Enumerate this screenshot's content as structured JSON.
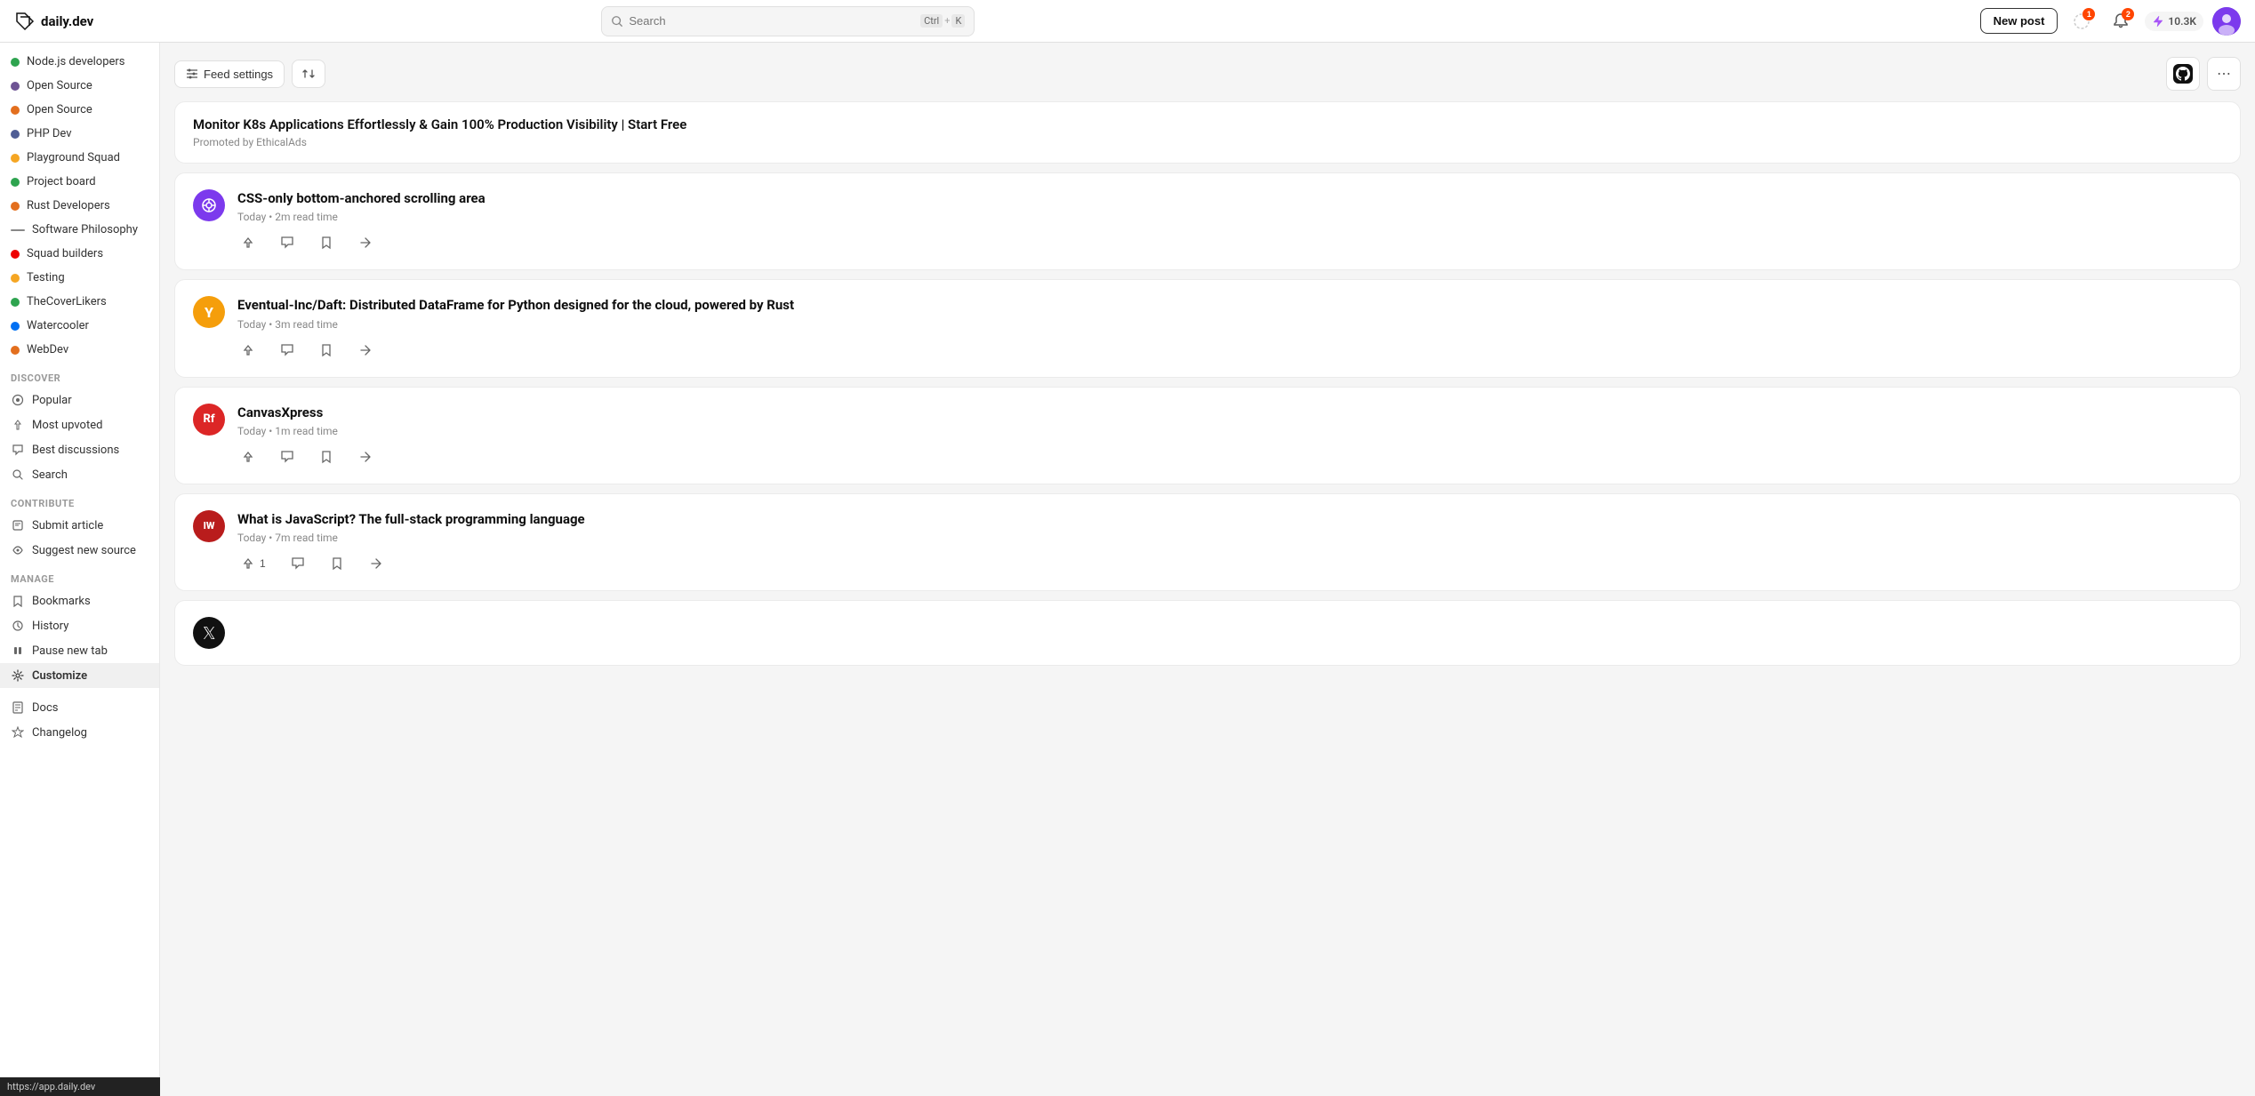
{
  "app": {
    "name": "daily.dev"
  },
  "topnav": {
    "search_placeholder": "Search",
    "shortcut_ctrl": "Ctrl",
    "shortcut_plus": "+",
    "shortcut_key": "K",
    "new_post_label": "New post",
    "notification_count": "1",
    "notification_badge": "2",
    "rep_count": "10.3K"
  },
  "sidebar": {
    "squads_label": "",
    "items_top": [
      {
        "label": "Node.js developers",
        "color": "#2ea44f",
        "type": "dot"
      },
      {
        "label": "Open Source",
        "color": "#6e5494",
        "type": "dot"
      },
      {
        "label": "Open Source",
        "color": "#e36f1e",
        "type": "dot"
      },
      {
        "label": "PHP Dev",
        "color": "#4f5d95",
        "type": "dot"
      },
      {
        "label": "Playground Squad",
        "color": "#f5a623",
        "type": "dot"
      },
      {
        "label": "Project board",
        "color": "#2ea44f",
        "type": "dot"
      },
      {
        "label": "Rust Developers",
        "color": "#e36f1e",
        "type": "dot"
      },
      {
        "label": "Software Philosophy",
        "color": "#555",
        "type": "dot"
      },
      {
        "label": "Squad builders",
        "color": "#e00",
        "type": "dot"
      },
      {
        "label": "Testing",
        "color": "#f5a623",
        "type": "dot"
      },
      {
        "label": "TheCoverLikers",
        "color": "#2ea44f",
        "type": "dot"
      },
      {
        "label": "Watercooler",
        "color": "#0070f3",
        "type": "dot"
      },
      {
        "label": "WebDev",
        "color": "#e36f1e",
        "type": "dot"
      }
    ],
    "discover_label": "Discover",
    "discover_items": [
      {
        "label": "Popular",
        "icon": "popular"
      },
      {
        "label": "Most upvoted",
        "icon": "upvote"
      },
      {
        "label": "Best discussions",
        "icon": "discussion"
      },
      {
        "label": "Search",
        "icon": "search"
      }
    ],
    "contribute_label": "Contribute",
    "contribute_items": [
      {
        "label": "Submit article",
        "icon": "article"
      },
      {
        "label": "Suggest new source",
        "icon": "source"
      }
    ],
    "manage_label": "Manage",
    "manage_items": [
      {
        "label": "Bookmarks",
        "icon": "bookmark"
      },
      {
        "label": "History",
        "icon": "history"
      },
      {
        "label": "Pause new tab",
        "icon": "pause"
      },
      {
        "label": "Customize",
        "icon": "customize",
        "active": true
      }
    ],
    "bottom_items": [
      {
        "label": "Docs",
        "icon": "docs"
      },
      {
        "label": "Changelog",
        "icon": "changelog"
      }
    ],
    "tooltip": "https://app.daily.dev"
  },
  "feed": {
    "feed_settings_label": "Feed settings",
    "sort_label": "",
    "posts": [
      {
        "type": "ad",
        "title": "Monitor K8s Applications Effortlessly & Gain 100% Production Visibility | Start Free",
        "promo": "Promoted by EthicalAds"
      },
      {
        "type": "post",
        "source_letter": "",
        "source_color": "#7c3aed",
        "source_icon_type": "crosshair",
        "title": "CSS-only bottom-anchored scrolling area",
        "meta": "Today • 2m read time",
        "upvotes": "",
        "comments": "",
        "bookmarked": false
      },
      {
        "type": "post",
        "source_letter": "Y",
        "source_color": "#f59e0b",
        "title": "Eventual-Inc/Daft: Distributed DataFrame for Python designed for the cloud, powered by Rust",
        "meta": "Today • 3m read time",
        "upvotes": "",
        "comments": "",
        "bookmarked": false
      },
      {
        "type": "post",
        "source_letter": "Rf",
        "source_color": "#dc2626",
        "title": "CanvasXpress",
        "meta": "Today • 1m read time",
        "upvotes": "",
        "comments": "",
        "bookmarked": false
      },
      {
        "type": "post",
        "source_letter": "IW",
        "source_color": "#b91c1c",
        "title": "What is JavaScript? The full-stack programming language",
        "meta": "Today • 7m read time",
        "upvotes": "1",
        "comments": "",
        "bookmarked": false
      },
      {
        "type": "post",
        "source_letter": "X",
        "source_color": "#111",
        "title": "",
        "meta": "",
        "upvotes": "",
        "comments": "",
        "bookmarked": false
      }
    ]
  }
}
